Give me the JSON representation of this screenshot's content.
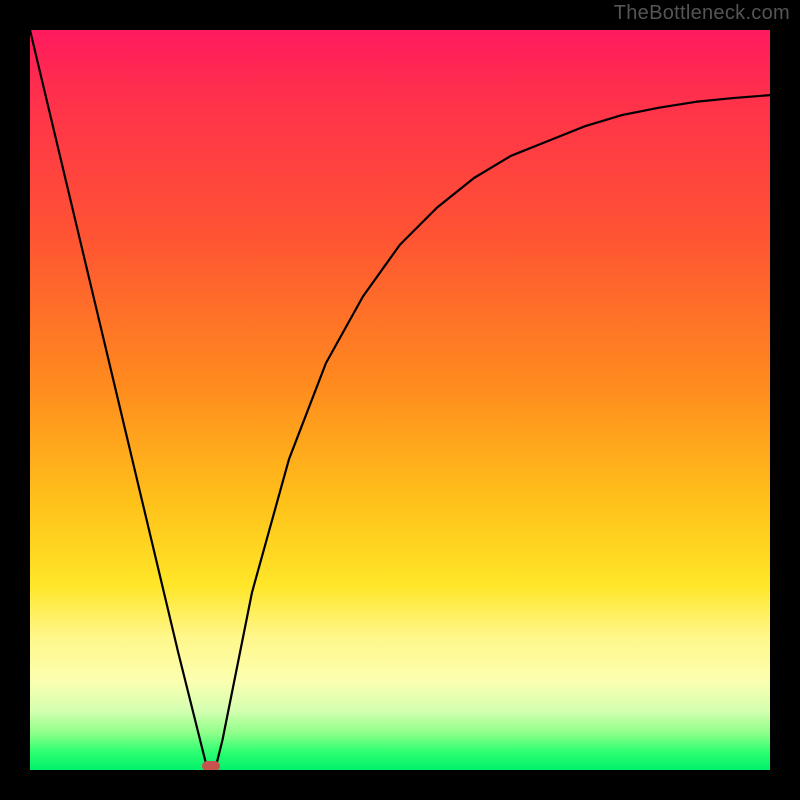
{
  "watermark": "TheBottleneck.com",
  "chart_data": {
    "type": "line",
    "title": "",
    "xlabel": "",
    "ylabel": "",
    "xlim": [
      0,
      100
    ],
    "ylim": [
      0,
      100
    ],
    "grid": false,
    "legend": false,
    "x": [
      0,
      5,
      10,
      15,
      20,
      24,
      25,
      26,
      30,
      35,
      40,
      45,
      50,
      55,
      60,
      65,
      70,
      75,
      80,
      85,
      90,
      95,
      100
    ],
    "values": [
      100,
      79,
      58,
      37,
      16,
      0,
      0,
      4,
      24,
      42,
      55,
      64,
      71,
      76,
      80,
      83,
      85,
      87,
      88.5,
      89.5,
      90.3,
      90.8,
      91.2
    ],
    "min_marker": {
      "x": 24.5,
      "y": 0
    },
    "background_gradient": {
      "type": "vertical",
      "stops": [
        {
          "pos": 0.0,
          "color": "#ff1a5e"
        },
        {
          "pos": 0.28,
          "color": "#ff5433"
        },
        {
          "pos": 0.64,
          "color": "#ffc21a"
        },
        {
          "pos": 0.82,
          "color": "#fff78a"
        },
        {
          "pos": 0.95,
          "color": "#8fff8a"
        },
        {
          "pos": 1.0,
          "color": "#00f06a"
        }
      ]
    }
  }
}
